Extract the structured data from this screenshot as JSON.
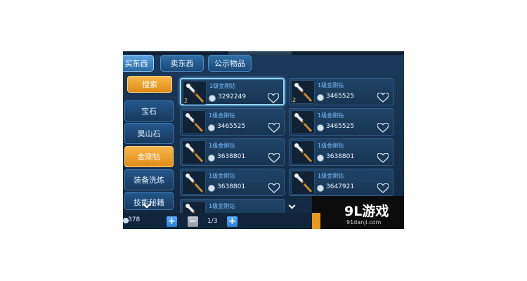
{
  "tabs": [
    {
      "label": "买东西",
      "active": true
    },
    {
      "label": "卖东西",
      "active": false
    },
    {
      "label": "公示物品",
      "active": false
    }
  ],
  "sidebar": {
    "items": [
      {
        "label": "搜索",
        "style": "orange"
      },
      {
        "label": "宝石",
        "style": "blue"
      },
      {
        "label": "昊山石",
        "style": "blue"
      },
      {
        "label": "金刚钻",
        "style": "orange"
      },
      {
        "label": "装备洗炼",
        "style": "blue"
      },
      {
        "label": "技能秘籍",
        "style": "blue"
      }
    ]
  },
  "items": [
    {
      "name": "1级金刚钻",
      "level": "2",
      "price": "3292249",
      "selected": true
    },
    {
      "name": "1级金刚钻",
      "level": "2",
      "price": "3465525",
      "selected": false
    },
    {
      "name": "1级金刚钻",
      "level": "",
      "price": "3465525",
      "selected": false
    },
    {
      "name": "1级金刚钻",
      "level": "",
      "price": "3465525",
      "selected": false
    },
    {
      "name": "1级金刚钻",
      "level": "",
      "price": "3638801",
      "selected": false
    },
    {
      "name": "1级金刚钻",
      "level": "",
      "price": "3638801",
      "selected": false
    },
    {
      "name": "1级金刚钻",
      "level": "",
      "price": "3638801",
      "selected": false
    },
    {
      "name": "1级金刚钻",
      "level": "",
      "price": "3647921",
      "selected": false
    },
    {
      "name": "1级金刚钻",
      "level": "",
      "price": "",
      "selected": false
    }
  ],
  "footer": {
    "currency_value": "378",
    "page_indicator": "1/3",
    "plus_symbol": "+",
    "minus_symbol": "−"
  },
  "watermark": {
    "main": "9L游戏",
    "sub": "91danji.com"
  },
  "colors": {
    "accent_orange": "#e08b15",
    "panel_blue": "#1b3a5c",
    "price_text": "#eaf4ff",
    "name_text": "#7ec0ff"
  }
}
